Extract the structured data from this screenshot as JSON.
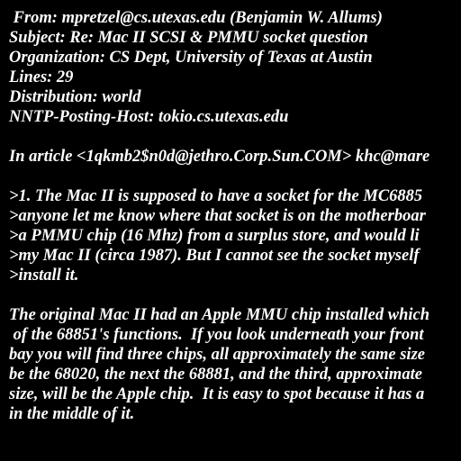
{
  "colors": {
    "background": "#000000",
    "text": "#ffffff"
  },
  "message": {
    "headers": [
      " From: mpretzel@cs.utexas.edu (Benjamin W. Allums)",
      "Subject: Re: Mac II SCSI & PMMU socket question",
      "Organization: CS Dept, University of Texas at Austin",
      "Lines: 29",
      "Distribution: world",
      "NNTP-Posting-Host: tokio.cs.utexas.edu"
    ],
    "attribution": "In article <1qkmb2$n0d@jethro.Corp.Sun.COM> khc@mare",
    "quoted": [
      ">1. The Mac II is supposed to have a socket for the MC6885",
      ">anyone let me know where that socket is on the motherboar",
      ">a PMMU chip (16 Mhz) from a surplus store, and would li",
      ">my Mac II (circa 1987). But I cannot see the socket myself",
      ">install it."
    ],
    "body": [
      "The original Mac II had an Apple MMU chip installed which",
      " of the 68851's functions.  If you look underneath your front",
      "bay you will find three chips, all approximately the same size",
      "be the 68020, the next the 68881, and the third, approximate",
      "size, will be the Apple chip.  It is easy to spot because it has a",
      "in the middle of it."
    ]
  }
}
